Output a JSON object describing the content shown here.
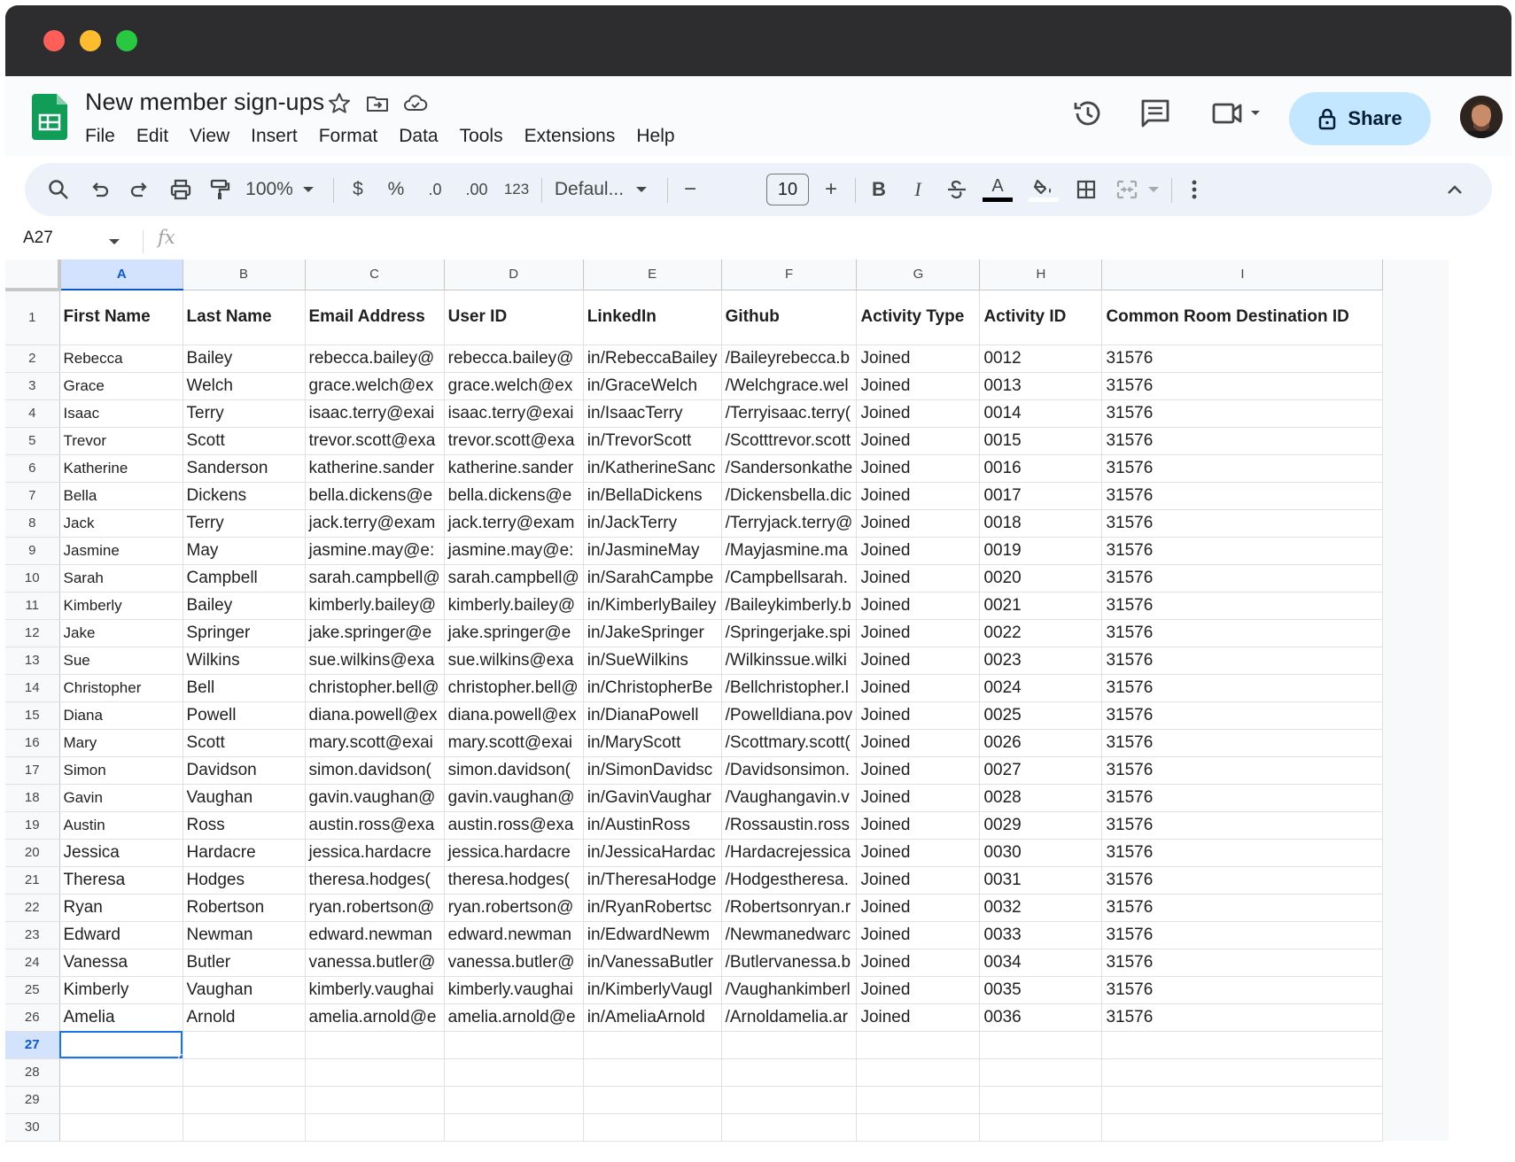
{
  "doc": {
    "title": "New member sign-ups",
    "menus": [
      "File",
      "Edit",
      "View",
      "Insert",
      "Format",
      "Data",
      "Tools",
      "Extensions",
      "Help"
    ],
    "share_label": "Share"
  },
  "toolbar": {
    "zoom": "100%",
    "currency": "$",
    "percent": "%",
    "decrease_decimal": ".0",
    "increase_decimal": ".00",
    "number_format": "123",
    "font": "Defaul...",
    "font_size": "10",
    "minus": "−",
    "plus": "+",
    "bold": "B",
    "italic": "I",
    "text_color_letter": "A"
  },
  "formula_bar": {
    "cell_ref": "A27",
    "fx": "fx"
  },
  "sheet": {
    "columns": [
      "A",
      "B",
      "C",
      "D",
      "E",
      "F",
      "G",
      "H",
      "I"
    ],
    "selected_column": "A",
    "selected_row": "27",
    "header_row": [
      "First Name",
      "Last Name",
      "Email Address",
      "User ID",
      "LinkedIn",
      "Github",
      "Activity Type",
      "Activity ID",
      "Common Room Destination ID"
    ],
    "rows": [
      [
        "Rebecca",
        "Bailey",
        "rebecca.bailey@",
        "rebecca.bailey@",
        "in/RebeccaBailey",
        "/Baileyrebecca.b",
        "Joined",
        "0012",
        "31576"
      ],
      [
        "Grace",
        "Welch",
        "grace.welch@ex",
        "grace.welch@ex",
        "in/GraceWelch",
        "/Welchgrace.wel",
        "Joined",
        "0013",
        "31576"
      ],
      [
        "Isaac",
        "Terry",
        "isaac.terry@exai",
        "isaac.terry@exai",
        "in/IsaacTerry",
        "/Terryisaac.terry(",
        "Joined",
        "0014",
        "31576"
      ],
      [
        "Trevor",
        "Scott",
        "trevor.scott@exa",
        "trevor.scott@exa",
        "in/TrevorScott",
        "/Scotttrevor.scott",
        "Joined",
        "0015",
        "31576"
      ],
      [
        "Katherine",
        "Sanderson",
        "katherine.sander",
        "katherine.sander",
        "in/KatherineSanc",
        "/Sandersonkathe",
        "Joined",
        "0016",
        "31576"
      ],
      [
        "Bella",
        "Dickens",
        "bella.dickens@e",
        "bella.dickens@e",
        "in/BellaDickens",
        "/Dickensbella.dic",
        "Joined",
        "0017",
        "31576"
      ],
      [
        "Jack",
        "Terry",
        "jack.terry@exam",
        "jack.terry@exam",
        "in/JackTerry",
        "/Terryjack.terry@",
        "Joined",
        "0018",
        "31576"
      ],
      [
        "Jasmine",
        "May",
        "jasmine.may@e:",
        "jasmine.may@e:",
        "in/JasmineMay",
        "/Mayjasmine.ma",
        "Joined",
        "0019",
        "31576"
      ],
      [
        "Sarah",
        "Campbell",
        "sarah.campbell@",
        "sarah.campbell@",
        "in/SarahCampbe",
        "/Campbellsarah.",
        "Joined",
        "0020",
        "31576"
      ],
      [
        "Kimberly",
        "Bailey",
        "kimberly.bailey@",
        "kimberly.bailey@",
        "in/KimberlyBailey",
        "/Baileykimberly.b",
        "Joined",
        "0021",
        "31576"
      ],
      [
        "Jake",
        "Springer",
        "jake.springer@e",
        "jake.springer@e",
        "in/JakeSpringer",
        "/Springerjake.spi",
        "Joined",
        "0022",
        "31576"
      ],
      [
        "Sue",
        "Wilkins",
        "sue.wilkins@exa",
        "sue.wilkins@exa",
        "in/SueWilkins",
        "/Wilkinssue.wilki",
        "Joined",
        "0023",
        "31576"
      ],
      [
        "Christopher",
        "Bell",
        "christopher.bell@",
        "christopher.bell@",
        "in/ChristopherBe",
        "/Bellchristopher.l",
        "Joined",
        "0024",
        "31576"
      ],
      [
        "Diana",
        "Powell",
        "diana.powell@ex",
        "diana.powell@ex",
        "in/DianaPowell",
        "/Powelldiana.pov",
        "Joined",
        "0025",
        "31576"
      ],
      [
        "Mary",
        "Scott",
        "mary.scott@exai",
        "mary.scott@exai",
        "in/MaryScott",
        "/Scottmary.scott(",
        "Joined",
        "0026",
        "31576"
      ],
      [
        "Simon",
        "Davidson",
        "simon.davidson(",
        "simon.davidson(",
        "in/SimonDavidsc",
        "/Davidsonsimon.",
        "Joined",
        "0027",
        "31576"
      ],
      [
        "Gavin",
        "Vaughan",
        "gavin.vaughan@",
        "gavin.vaughan@",
        "in/GavinVaughar",
        "/Vaughangavin.v",
        "Joined",
        "0028",
        "31576"
      ],
      [
        "Austin",
        "Ross",
        "austin.ross@exa",
        "austin.ross@exa",
        "in/AustinRoss",
        "/Rossaustin.ross",
        "Joined",
        "0029",
        "31576"
      ],
      [
        "Jessica",
        "Hardacre",
        "jessica.hardacre",
        "jessica.hardacre",
        "in/JessicaHardac",
        "/Hardacrejessica",
        "Joined",
        "0030",
        "31576"
      ],
      [
        "Theresa",
        "Hodges",
        "theresa.hodges(",
        "theresa.hodges(",
        "in/TheresaHodge",
        "/Hodgestheresa.",
        "Joined",
        "0031",
        "31576"
      ],
      [
        "Ryan",
        "Robertson",
        "ryan.robertson@",
        "ryan.robertson@",
        "in/RyanRobertsc",
        "/Robertsonryan.r",
        "Joined",
        "0032",
        "31576"
      ],
      [
        "Edward",
        "Newman",
        "edward.newman",
        "edward.newman",
        "in/EdwardNewm",
        "/Newmanedwarc",
        "Joined",
        "0033",
        "31576"
      ],
      [
        "Vanessa",
        "Butler",
        "vanessa.butler@",
        "vanessa.butler@",
        "in/VanessaButler",
        "/Butlervanessa.b",
        "Joined",
        "0034",
        "31576"
      ],
      [
        "Kimberly",
        "Vaughan",
        "kimberly.vaughai",
        "kimberly.vaughai",
        "in/KimberlyVaugl",
        "/Vaughankimberl",
        "Joined",
        "0035",
        "31576"
      ],
      [
        "Amelia",
        "Arnold",
        "amelia.arnold@e",
        "amelia.arnold@e",
        "in/AmeliaArnold",
        "/Arnoldamelia.ar",
        "Joined",
        "0036",
        "31576"
      ]
    ],
    "empty_rows": [
      "27",
      "28",
      "29",
      "30"
    ]
  },
  "colors": {
    "titlebar": "#2d2d2f",
    "share_bg": "#c2e7ff",
    "selection": "#1a73e8",
    "header_bg": "#f8f9fa",
    "sheets_green": "#0f9d58"
  },
  "icons": [
    "star-icon",
    "move-folder-icon",
    "cloud-saved-icon",
    "history-icon",
    "comment-icon",
    "meet-icon",
    "lock-icon",
    "search-icon",
    "undo-icon",
    "redo-icon",
    "print-icon",
    "paint-format-icon",
    "text-color-icon",
    "fill-color-icon",
    "borders-icon",
    "merge-icon",
    "more-vert-icon",
    "chevron-up-icon"
  ]
}
